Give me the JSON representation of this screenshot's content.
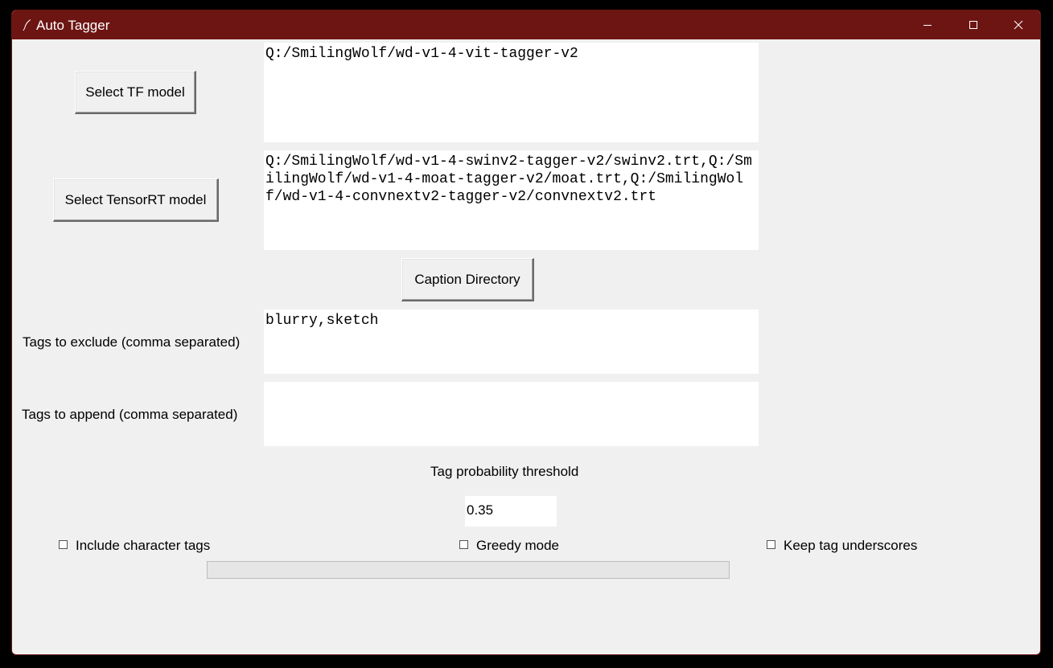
{
  "window": {
    "title": "Auto Tagger",
    "title_bar_color": "#6d1513",
    "controls": [
      "minimize-icon",
      "maximize-icon",
      "close-icon"
    ]
  },
  "tf_model": {
    "button_label": "Select TF model",
    "path": "Q:/SmilingWolf/wd-v1-4-vit-tagger-v2"
  },
  "tensorrt_model": {
    "button_label": "Select TensorRT model",
    "paths": "Q:/SmilingWolf/wd-v1-4-swinv2-tagger-v2/swinv2.trt,Q:/SmilingWolf/wd-v1-4-moat-tagger-v2/moat.trt,Q:/SmilingWolf/wd-v1-4-convnextv2-tagger-v2/convnextv2.trt"
  },
  "caption_directory": {
    "button_label": "Caption Directory"
  },
  "exclude_tags": {
    "label": "Tags to exclude (comma separated)",
    "value": "blurry,sketch"
  },
  "append_tags": {
    "label": "Tags to append (comma separated)",
    "value": ""
  },
  "threshold": {
    "label": "Tag probability threshold",
    "value": "0.35"
  },
  "options": {
    "include_character_tags": {
      "label": "Include character tags",
      "checked": false
    },
    "greedy_mode": {
      "label": "Greedy mode",
      "checked": false
    },
    "keep_tag_underscores": {
      "label": "Keep tag underscores",
      "checked": false
    }
  },
  "progress": {
    "fraction": 0
  }
}
